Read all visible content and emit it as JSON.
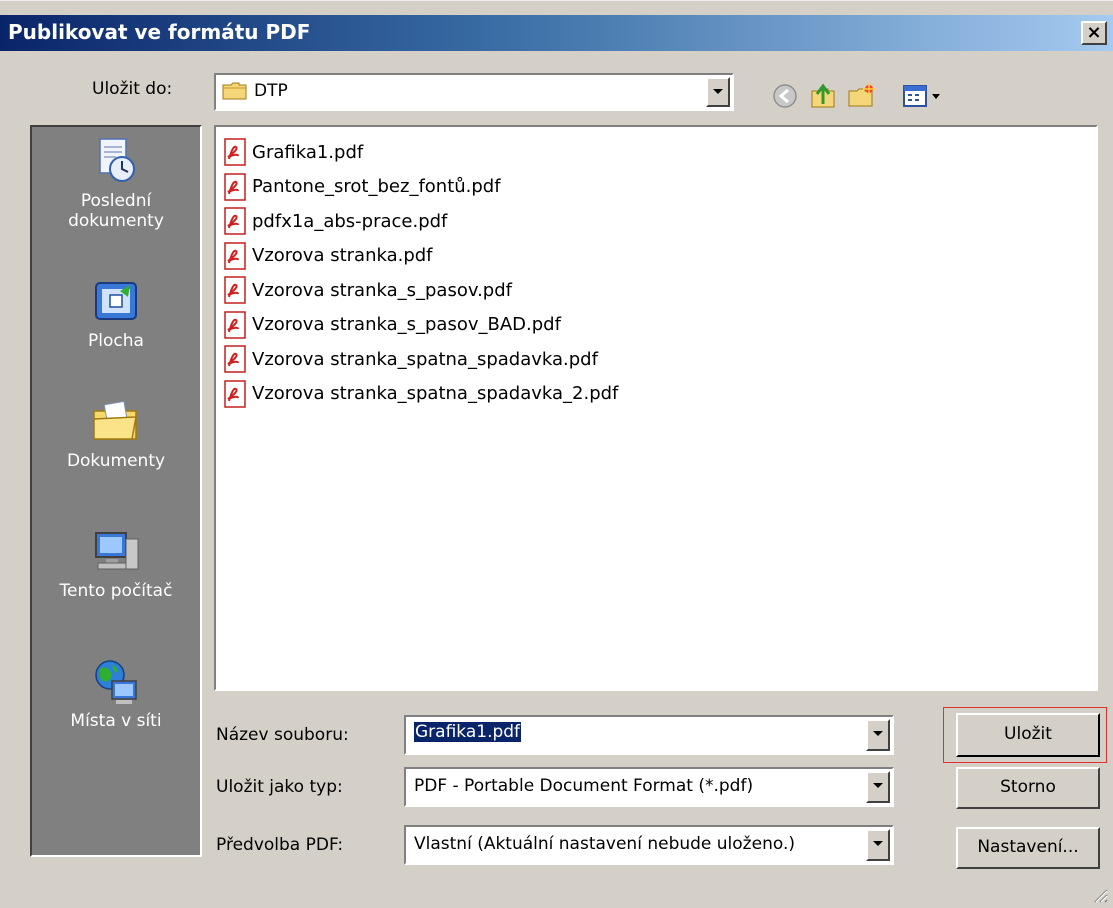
{
  "window": {
    "title": "Publikovat ve formátu PDF",
    "close_label": "×"
  },
  "toolbar": {
    "save_in_label": "Uložit do:",
    "save_in_value": "DTP",
    "icons": [
      "back-icon",
      "up-folder-icon",
      "new-folder-icon",
      "view-menu-icon"
    ]
  },
  "places": [
    {
      "label": "Poslední dokumenty",
      "icon": "recent-documents-icon"
    },
    {
      "label": "Plocha",
      "icon": "desktop-icon"
    },
    {
      "label": "Dokumenty",
      "icon": "documents-folder-icon"
    },
    {
      "label": "Tento počítač",
      "icon": "my-computer-icon"
    },
    {
      "label": "Místa v síti",
      "icon": "network-places-icon"
    }
  ],
  "files": [
    "Grafika1.pdf",
    "Pantone_srot_bez_fontů.pdf",
    "pdfx1a_abs-prace.pdf",
    "Vzorova stranka.pdf",
    "Vzorova stranka_s_pasov.pdf",
    "Vzorova stranka_s_pasov_BAD.pdf",
    "Vzorova stranka_spatna_spadavka.pdf",
    "Vzorova stranka_spatna_spadavka_2.pdf"
  ],
  "form": {
    "filename_label": "Název souboru:",
    "filename_value": "Grafika1.pdf",
    "filetype_label": "Uložit jako typ:",
    "filetype_value": "PDF - Portable Document Format (*.pdf)",
    "preset_label": "Předvolba PDF:",
    "preset_value": "Vlastní (Aktuální nastavení nebude uloženo.)"
  },
  "buttons": {
    "save": "Uložit",
    "cancel": "Storno",
    "settings": "Nastavení..."
  },
  "colors": {
    "title_start": "#0a246a",
    "title_end": "#a6caf0",
    "face": "#d4d0c8",
    "places_bg": "#808080",
    "selection": "#0a246a",
    "highlight_outline": "#e03030"
  }
}
